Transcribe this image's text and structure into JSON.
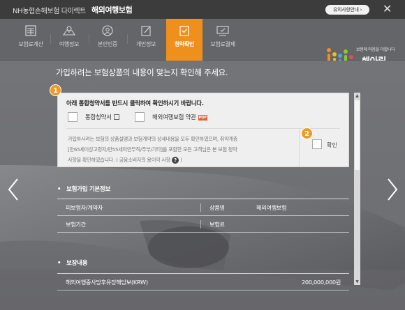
{
  "topbar": {
    "brand": "NH농협손해보험 다이렉트",
    "service": "해외여행보험",
    "notice_button": "유의사항안내 ›",
    "close": "✕"
  },
  "steps": [
    {
      "label": "보험료계산",
      "icon": "calculator-icon",
      "active": false
    },
    {
      "label": "여행정보",
      "icon": "map-icon",
      "active": false
    },
    {
      "label": "본인인증",
      "icon": "user-verify-icon",
      "active": false
    },
    {
      "label": "개인정보",
      "icon": "edit-icon",
      "active": false
    },
    {
      "label": "청약확인",
      "icon": "check-icon",
      "active": true
    },
    {
      "label": "보험료결제",
      "icon": "payment-icon",
      "active": false
    }
  ],
  "logo": {
    "tagline": "보험에 마음을 더합니다",
    "name": "해아림"
  },
  "main": {
    "heading": "가입하려는 보험상품의 내용이 맞는지 확인해 주세요."
  },
  "consent": {
    "badge1": "1",
    "badge2": "2",
    "intro": "아래 통합청약서를 반드시 클릭하여 확인하시기 바랍니다.",
    "doc1_label": "통합청약서",
    "doc2_label": "해외여행보험 약관",
    "pdf_tag": "PDF",
    "description_line1": "가입하시려는 보험의 상품설명과 보험계약의 상세내용을 모두 확인하였으며, 취약계층",
    "description_line2": "[만65세이상고령자/만55세미만무직/주부/기타]를 포함한 모든 고객님은 본 보험 청약",
    "description_line3": "사항을 확인하였습니다. ( 금융소비자의 용이익 사항",
    "description_line3_end": ")",
    "help_icon_text": "?",
    "confirm_label": "확인"
  },
  "basic_info": {
    "title": "보험가입 기본정보",
    "rows": [
      {
        "label1": "피보험자/계약자",
        "value1": "",
        "label2": "상품명",
        "value2": "해외여행보험"
      },
      {
        "label1": "보험기간",
        "value1": "",
        "label2": "보험료",
        "value2": ""
      }
    ]
  },
  "coverage": {
    "title": "보장내용",
    "rows": [
      {
        "name": "해외여행중사망후유장해담보(KRW)",
        "amount": "200,000,000원"
      }
    ]
  },
  "colors": {
    "accent": "#f0901c",
    "topbar": "#3c3c3c",
    "nav": "#646569"
  }
}
